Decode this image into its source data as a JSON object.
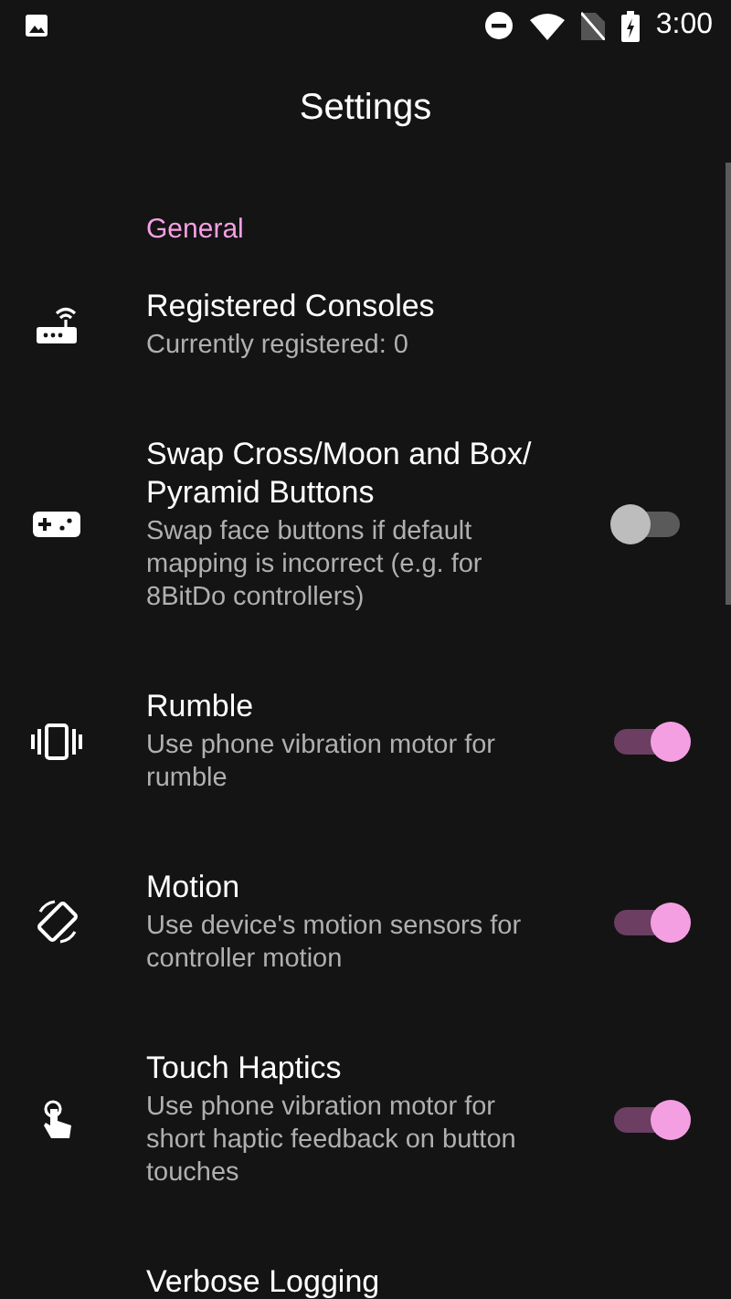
{
  "status_bar": {
    "time": "3:00"
  },
  "app_bar": {
    "title": "Settings"
  },
  "sections": [
    {
      "header": "General",
      "items": [
        {
          "kind": "link",
          "title": "Registered Consoles",
          "summary": "Currently registered: 0"
        },
        {
          "kind": "toggle",
          "title": "Swap Cross/Moon and Box/ Pyramid Buttons",
          "summary": "Swap face buttons if default mapping is incorrect (e.g. for 8BitDo controllers)",
          "on": false
        },
        {
          "kind": "toggle",
          "title": "Rumble",
          "summary": "Use phone vibration motor for rumble",
          "on": true
        },
        {
          "kind": "toggle",
          "title": "Motion",
          "summary": "Use device's motion sensors for controller motion",
          "on": true
        },
        {
          "kind": "toggle",
          "title": "Touch Haptics",
          "summary": "Use phone vibration motor for short haptic feedback on button touches",
          "on": true
        },
        {
          "kind": "link",
          "title": "Verbose Logging"
        }
      ]
    }
  ]
}
